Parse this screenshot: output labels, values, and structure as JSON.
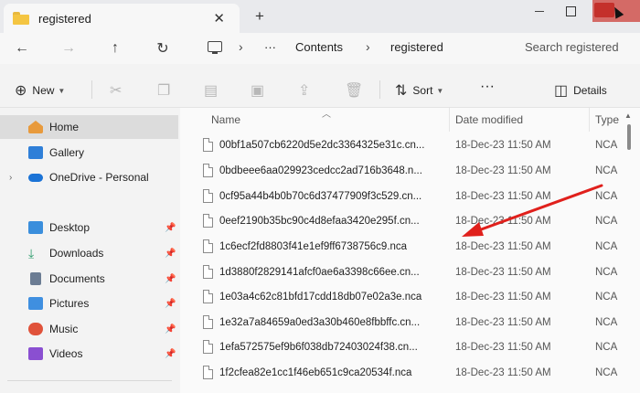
{
  "window": {
    "tab_title": "registered",
    "tab_close": "✕",
    "new_tab": "+"
  },
  "address": {
    "back": "←",
    "forward": "→",
    "up": "↑",
    "refresh": "↻",
    "more": "···",
    "sep": "›",
    "crumbs": [
      "Contents",
      "registered"
    ],
    "search_placeholder": "Search registered"
  },
  "commands": {
    "new_label": "New",
    "sort_label": "Sort",
    "more": "···",
    "details_label": "Details"
  },
  "sidebar": {
    "items": [
      {
        "label": "Home",
        "icon": "home-icon",
        "color": "#e89a3c"
      },
      {
        "label": "Gallery",
        "icon": "gallery-icon",
        "color": "#2f7fd8"
      },
      {
        "label": "OneDrive - Personal",
        "icon": "onedrive-icon",
        "color": "#1b73d6"
      },
      {
        "label": "Desktop",
        "icon": "desktop-icon",
        "color": "#3a8edc"
      },
      {
        "label": "Downloads",
        "icon": "downloads-icon",
        "color": "#2d9c6c"
      },
      {
        "label": "Documents",
        "icon": "documents-icon",
        "color": "#6b7c93"
      },
      {
        "label": "Pictures",
        "icon": "pictures-icon",
        "color": "#3f8fe0"
      },
      {
        "label": "Music",
        "icon": "music-icon",
        "color": "#e0523a"
      },
      {
        "label": "Videos",
        "icon": "videos-icon",
        "color": "#8a4fd1"
      }
    ]
  },
  "table": {
    "columns": {
      "name": "Name",
      "date": "Date modified",
      "type": "Type"
    },
    "rows": [
      {
        "name": "00bf1a507cb6220d5e2dc3364325e31c.cn...",
        "date": "18-Dec-23 11:50 AM",
        "type": "NCA"
      },
      {
        "name": "0bdbeee6aa029923cedcc2ad716b3648.n...",
        "date": "18-Dec-23 11:50 AM",
        "type": "NCA"
      },
      {
        "name": "0cf95a44b4b0b70c6d37477909f3c529.cn...",
        "date": "18-Dec-23 11:50 AM",
        "type": "NCA"
      },
      {
        "name": "0eef2190b35bc90c4d8efaa3420e295f.cn...",
        "date": "18-Dec-23 11:50 AM",
        "type": "NCA"
      },
      {
        "name": "1c6ecf2fd8803f41e1ef9ff6738756c9.nca",
        "date": "18-Dec-23 11:50 AM",
        "type": "NCA"
      },
      {
        "name": "1d3880f2829141afcf0ae6a3398c66ee.cn...",
        "date": "18-Dec-23 11:50 AM",
        "type": "NCA"
      },
      {
        "name": "1e03a4c62c81bfd17cdd18db07e02a3e.nca",
        "date": "18-Dec-23 11:50 AM",
        "type": "NCA"
      },
      {
        "name": "1e32a7a84659a0ed3a30b460e8fbbffc.cn...",
        "date": "18-Dec-23 11:50 AM",
        "type": "NCA"
      },
      {
        "name": "1efa572575ef9b6f038db72403024f38.cn...",
        "date": "18-Dec-23 11:50 AM",
        "type": "NCA"
      },
      {
        "name": "1f2cfea82e1cc1f46eb651c9ca20534f.nca",
        "date": "18-Dec-23 11:50 AM",
        "type": "NCA"
      }
    ]
  },
  "annotation": {
    "color": "#e0201c"
  }
}
